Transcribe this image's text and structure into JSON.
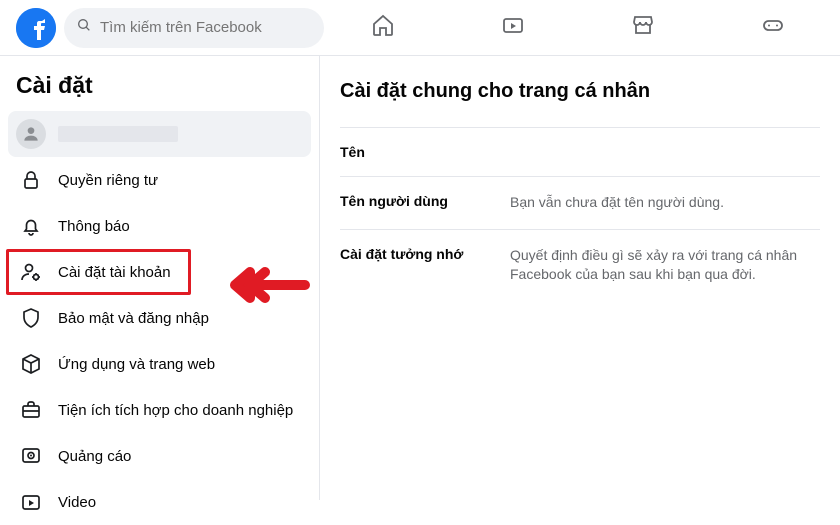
{
  "search": {
    "placeholder": "Tìm kiếm trên Facebook"
  },
  "sidebar": {
    "title": "Cài đặt",
    "items": [
      {
        "label": ""
      },
      {
        "label": "Quyền riêng tư"
      },
      {
        "label": "Thông báo"
      },
      {
        "label": "Cài đặt tài khoản"
      },
      {
        "label": "Bảo mật và đăng nhập"
      },
      {
        "label": "Ứng dụng và trang web"
      },
      {
        "label": "Tiện ích tích hợp cho doanh nghiệp"
      },
      {
        "label": "Quảng cáo"
      },
      {
        "label": "Video"
      }
    ]
  },
  "main": {
    "title": "Cài đặt chung cho trang cá nhân",
    "rows": [
      {
        "label": "Tên",
        "value": ""
      },
      {
        "label": "Tên người dùng",
        "value": "Bạn vẫn chưa đặt tên người dùng."
      },
      {
        "label": "Cài đặt tưởng nhớ",
        "value": "Quyết định điều gì sẽ xảy ra với trang cá nhân Facebook của bạn sau khi bạn qua đời."
      }
    ]
  }
}
